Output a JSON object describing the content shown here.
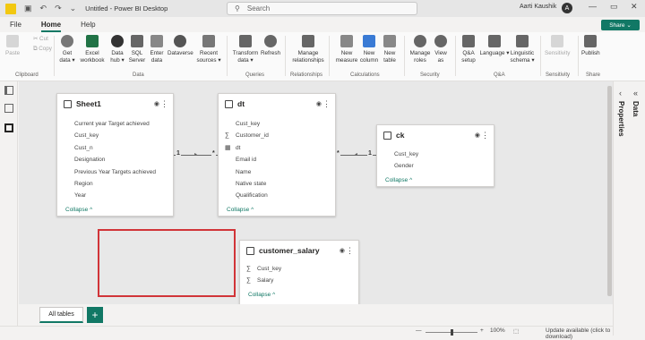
{
  "window": {
    "title": "Untitled - Power BI Desktop",
    "search_placeholder": "Search",
    "user_name": "Aarti Kaushik",
    "user_initial": "A",
    "minimize": "—",
    "restore": "▭",
    "close": "✕",
    "undo": "↶",
    "redo": "↷",
    "dropdown": "⌄"
  },
  "menu": {
    "items": [
      "File",
      "Home",
      "Help"
    ],
    "active": "Home",
    "share_label": "Share ⌄"
  },
  "ribbon": {
    "buttons": [
      {
        "label": "Paste",
        "disabled": true,
        "color": "#d6d6d6"
      },
      {
        "label": "Cut",
        "disabled": true,
        "color": "#d6d6d6"
      },
      {
        "label": "Copy",
        "disabled": true,
        "color": "#d6d6d6"
      },
      {
        "label": "Get data ▾",
        "disabled": false,
        "color": "#777777"
      },
      {
        "label": "Excel workbook",
        "disabled": false,
        "color": "#217346"
      },
      {
        "label": "Data hub ▾",
        "disabled": false,
        "color": "#333333"
      },
      {
        "label": "SQL Server",
        "disabled": false,
        "color": "#666666"
      },
      {
        "label": "Enter data",
        "disabled": false,
        "color": "#888888"
      },
      {
        "label": "Dataverse",
        "disabled": false,
        "color": "#555555"
      },
      {
        "label": "Recent sources ▾",
        "disabled": false,
        "color": "#777777"
      },
      {
        "label": "Transform data ▾",
        "disabled": false,
        "color": "#666666"
      },
      {
        "label": "Refresh",
        "disabled": false,
        "color": "#666666"
      },
      {
        "label": "Manage relationships",
        "disabled": false,
        "color": "#666666"
      },
      {
        "label": "New measure",
        "disabled": false,
        "color": "#888888"
      },
      {
        "label": "New column",
        "disabled": false,
        "color": "#3a7bd5"
      },
      {
        "label": "New table",
        "disabled": false,
        "color": "#888888"
      },
      {
        "label": "Manage roles",
        "disabled": false,
        "color": "#666666"
      },
      {
        "label": "View as",
        "disabled": false,
        "color": "#666666"
      },
      {
        "label": "Q&A setup",
        "disabled": false,
        "color": "#666666"
      },
      {
        "label": "Language ▾",
        "disabled": false,
        "color": "#666666"
      },
      {
        "label": "Linguistic schema ▾",
        "disabled": false,
        "color": "#666666"
      },
      {
        "label": "Sensitivity",
        "disabled": true,
        "color": "#d6d6d6"
      },
      {
        "label": "Publish",
        "disabled": false,
        "color": "#666666"
      }
    ],
    "groups": [
      "Clipboard",
      "Data",
      "Queries",
      "Relationships",
      "Calculations",
      "Security",
      "Q&A",
      "Sensitivity",
      "Share"
    ]
  },
  "panes": {
    "properties": "Properties",
    "data": "Data"
  },
  "tables": {
    "sheet1": {
      "name": "Sheet1",
      "fields": [
        {
          "name": "Current year Target achieved",
          "icon": ""
        },
        {
          "name": "Cust_key",
          "icon": ""
        },
        {
          "name": "Cust_n",
          "icon": ""
        },
        {
          "name": "Designation",
          "icon": ""
        },
        {
          "name": "Previous Year Targets achieved",
          "icon": ""
        },
        {
          "name": "Region",
          "icon": ""
        },
        {
          "name": "Year",
          "icon": ""
        }
      ],
      "collapse": "Collapse ^"
    },
    "dt": {
      "name": "dt",
      "fields": [
        {
          "name": "Cust_key",
          "icon": ""
        },
        {
          "name": "Customer_id",
          "icon": "∑"
        },
        {
          "name": "dt",
          "icon": "▦"
        },
        {
          "name": "Email id",
          "icon": ""
        },
        {
          "name": "Name",
          "icon": ""
        },
        {
          "name": "Native state",
          "icon": ""
        },
        {
          "name": "Qualification",
          "icon": ""
        }
      ],
      "collapse": "Collapse ^"
    },
    "ck": {
      "name": "ck",
      "fields": [
        {
          "name": "Cust_key",
          "icon": ""
        },
        {
          "name": "Gender",
          "icon": ""
        }
      ],
      "collapse": "Collapse ^"
    },
    "customer_salary": {
      "name": "customer_salary",
      "fields": [
        {
          "name": "Cust_key",
          "icon": "∑"
        },
        {
          "name": "Salary",
          "icon": "∑"
        }
      ],
      "collapse": "Collapse ^"
    }
  },
  "relationships": {
    "rel1": {
      "from_card": "1",
      "to_card": "*"
    },
    "rel2": {
      "from_card": "*",
      "to_card": "1"
    }
  },
  "tabs": {
    "all_tables": "All tables",
    "add": "+"
  },
  "status": {
    "zoom": "100%",
    "update": "Update available (click to download)",
    "zoom_out": "—",
    "zoom_in": "+"
  },
  "colors": {
    "accent": "#117865",
    "highlight_box": "#d13438"
  }
}
